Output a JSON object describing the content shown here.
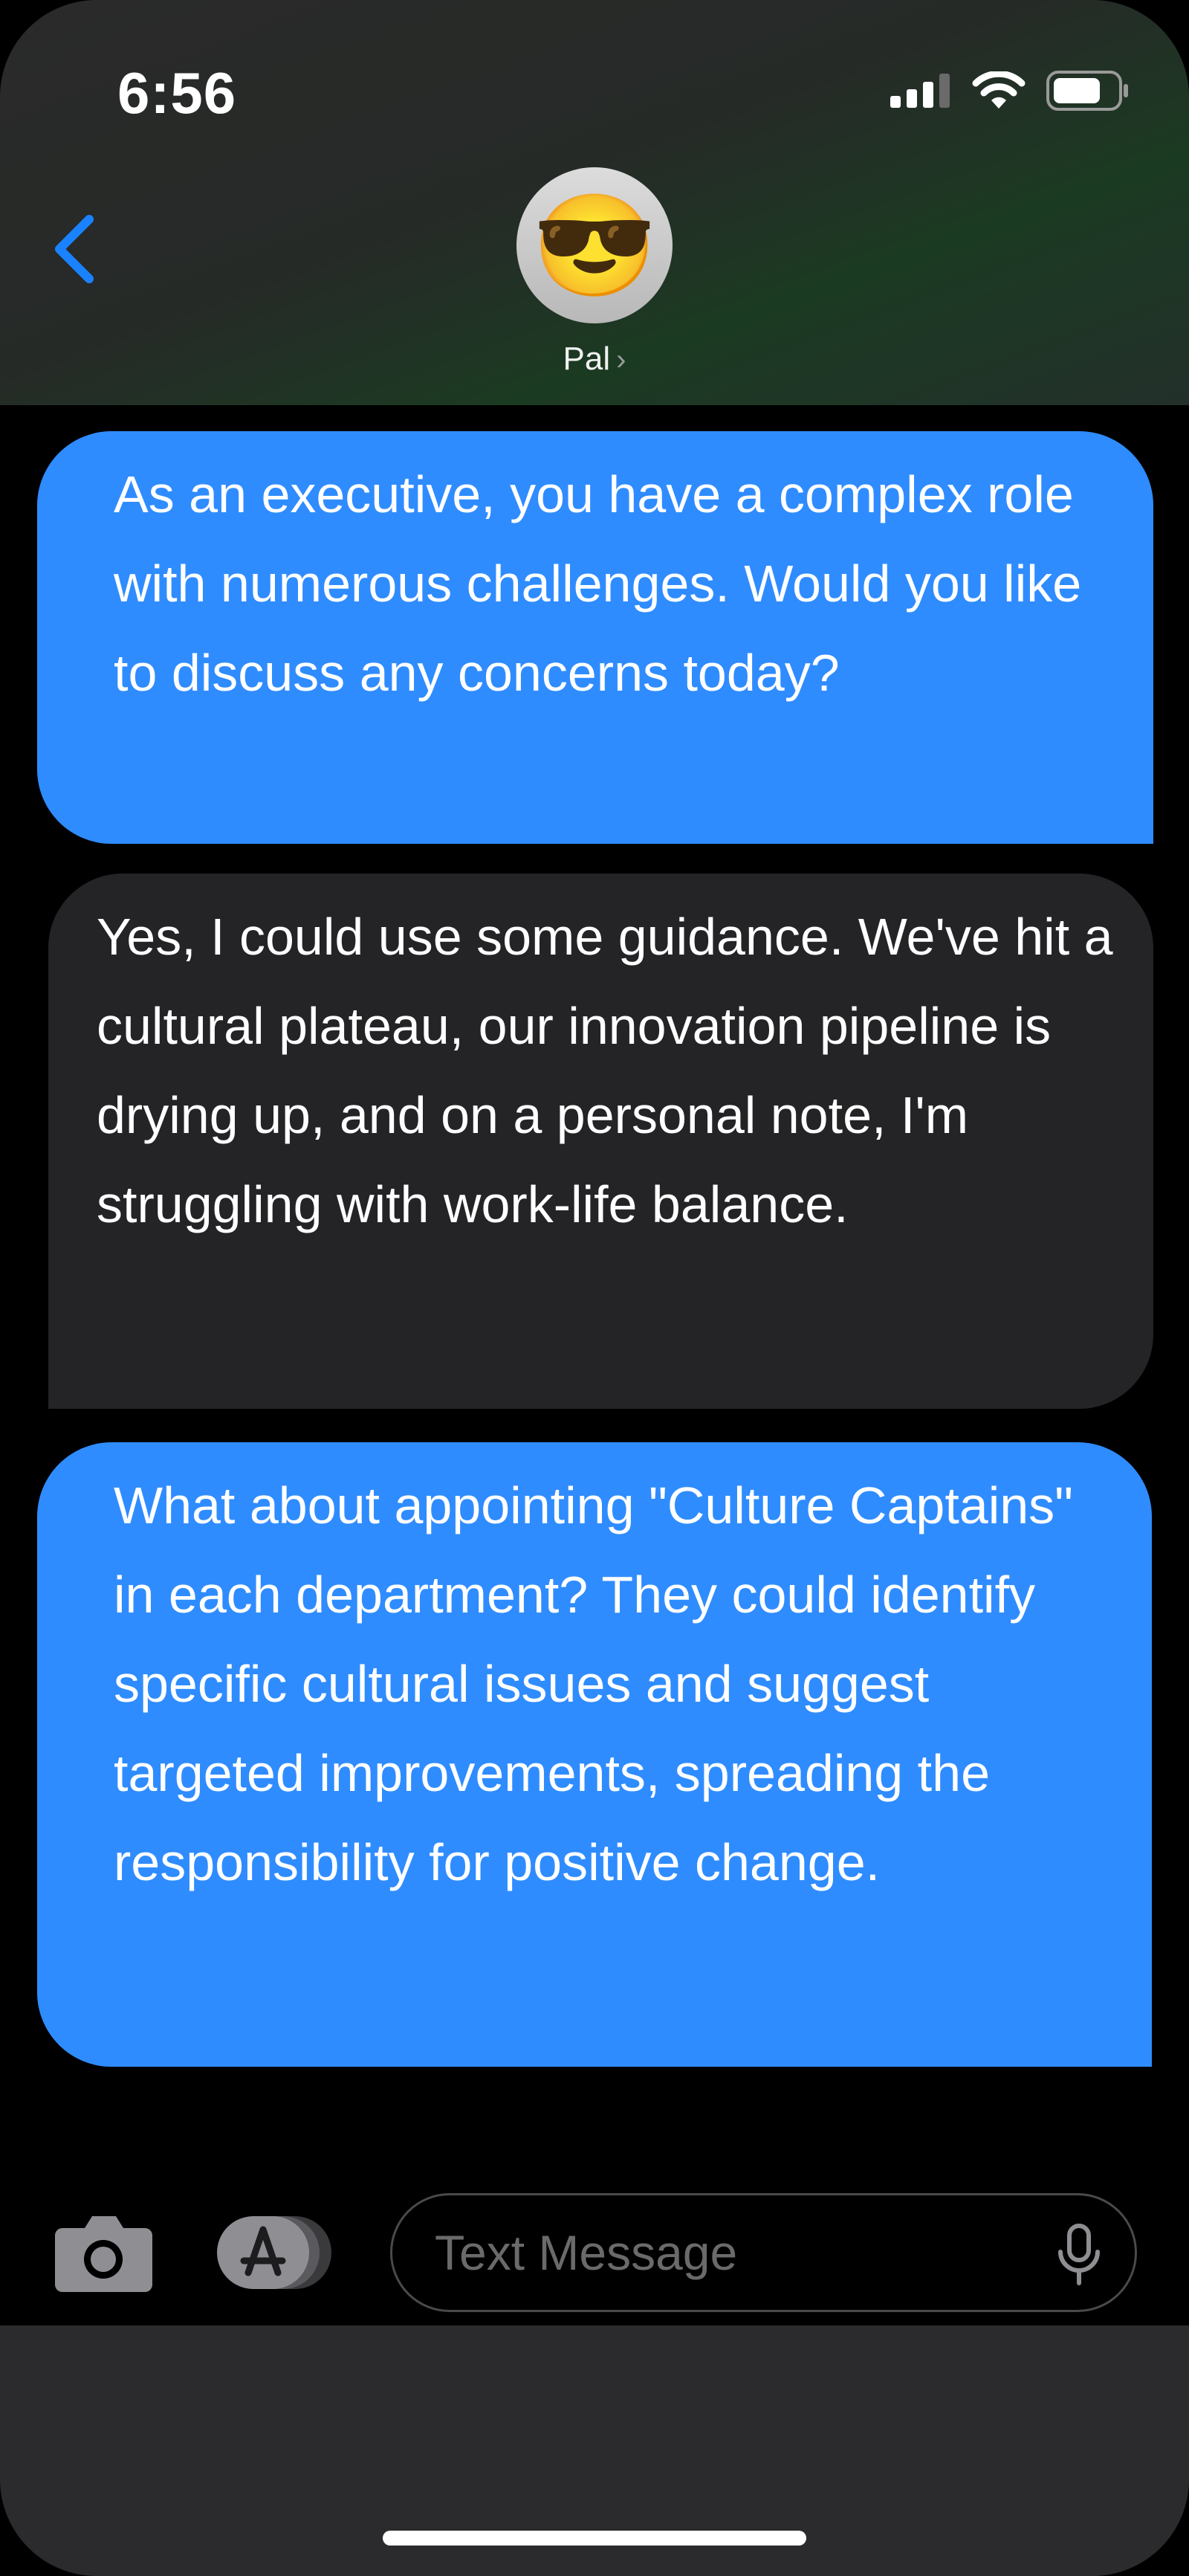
{
  "status_bar": {
    "time": "6:56"
  },
  "header": {
    "back_icon": "chevron-left-icon",
    "avatar_emoji": "😎",
    "contact_name": "Pal",
    "contact_chevron": "›"
  },
  "messages": [
    {
      "direction": "sent",
      "text": "As an executive, you have a complex role with numerous challenges. Would you like to discuss any concerns today?"
    },
    {
      "direction": "received",
      "text": "Yes, I could use some guidance. We've hit a cultural plateau, our innovation pipeline is drying up, and on a personal note, I'm struggling with work-life balance."
    },
    {
      "direction": "sent",
      "text": "What about appointing \"Culture Captains\" in each department? They could identify specific cultural issues and suggest targeted improvements, spreading the responsibility for positive change."
    }
  ],
  "input_bar": {
    "placeholder": "Text Message",
    "value": "",
    "camera_icon": "camera-icon",
    "appstore_icon": "app-store-icon",
    "mic_icon": "microphone-icon"
  },
  "colors": {
    "sent_bubble": "#2f8cff",
    "received_bubble": "#242427",
    "accent": "#1a82ff"
  }
}
